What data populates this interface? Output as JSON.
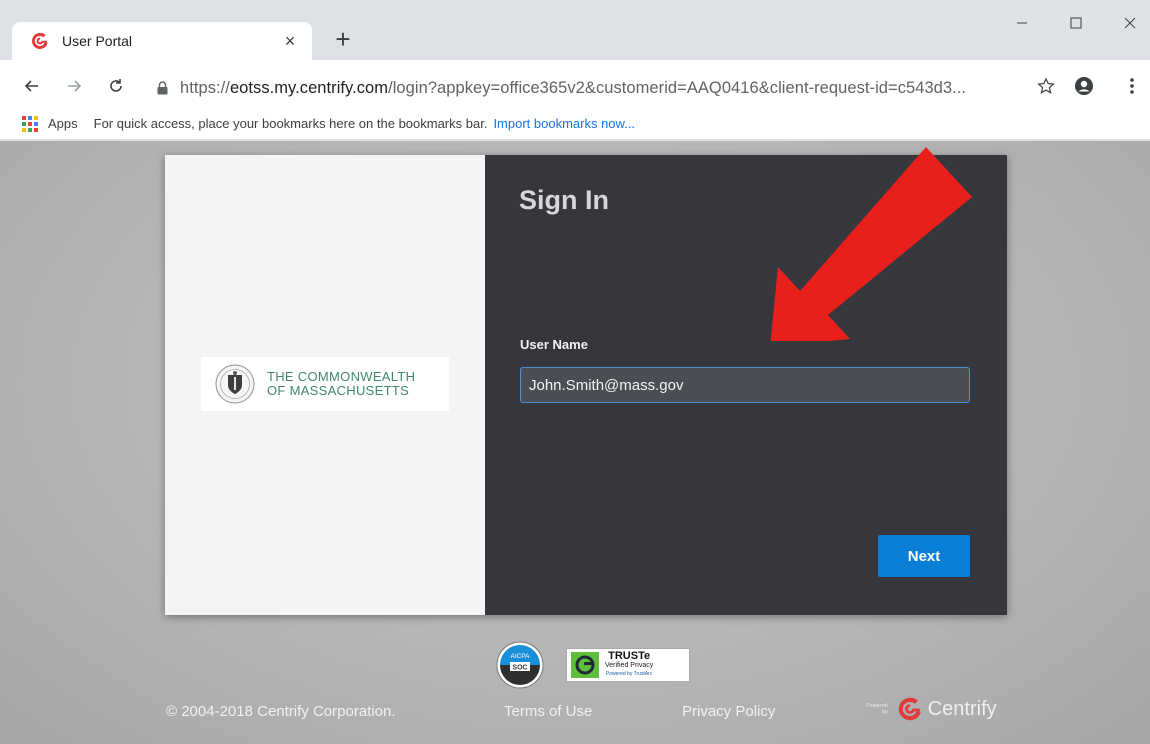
{
  "browser": {
    "tab_title": "User Portal",
    "new_tab_glyph": "+",
    "tab_close_glyph": "×",
    "url_scheme": "https://",
    "url_host": "eotss.my.centrify.com",
    "url_path": "/login?appkey=office365v2&customerid=AAQ0416&client-request-id=c543d3...",
    "bookmarks_apps_label": "Apps",
    "bookmarks_hint": "For quick access, place your bookmarks here on the bookmarks bar.",
    "bookmarks_import_link": "Import bookmarks now..."
  },
  "login": {
    "title": "Sign In",
    "username_label": "User Name",
    "username_value": "John.Smith@mass.gov",
    "next_label": "Next"
  },
  "org_logo": {
    "line1": "THE COMMONWEALTH",
    "line2": "OF MASSACHUSETTS"
  },
  "badges": {
    "aicpa_top": "AICPA",
    "aicpa_mid": "SOC",
    "truste_main": "TRUSTe",
    "truste_sub": "Verified Privacy",
    "truste_powered": "Powered by TrustArc"
  },
  "footer": {
    "copyright": "© 2004-2018 Centrify Corporation.",
    "terms_label": "Terms of Use",
    "privacy_label": "Privacy Policy",
    "powered_line1": "Powered",
    "powered_line2": "by",
    "brand_name": "Centrify"
  },
  "colors": {
    "accent_blue": "#0a7fd8",
    "arrow_red": "#e8201b",
    "panel_dark": "#35373d",
    "centrify_red": "#e23b3b"
  },
  "icons": [
    "centrify-favicon",
    "close-icon",
    "plus-icon",
    "minimize-icon",
    "maximize-icon",
    "window-close-icon",
    "back-arrow-icon",
    "forward-arrow-icon",
    "reload-icon",
    "lock-icon",
    "star-icon",
    "profile-icon",
    "menu-dots-icon",
    "apps-grid-icon",
    "seal-icon",
    "red-arrow-annotation"
  ]
}
